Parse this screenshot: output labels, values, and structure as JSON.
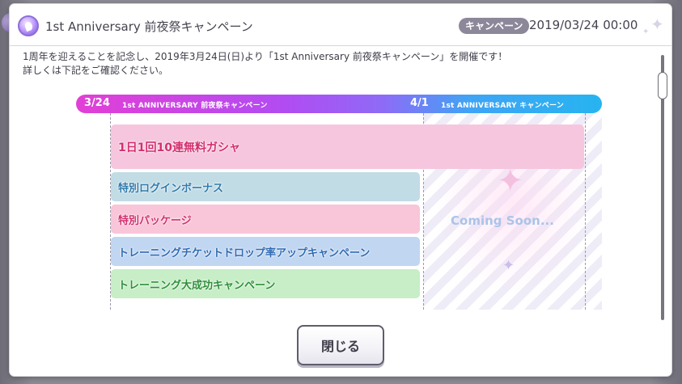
{
  "modal": {
    "title": "1st Anniversary 前夜祭キャンペーン",
    "badge": "キャンペーン",
    "date": "2019/03/24 00:00",
    "close_label": "閉じる"
  },
  "intro": {
    "line1": "1周年を迎えることを記念し、2019年3月24日(日)より「1st Anniversary 前夜祭キャンペーン」を開催です！",
    "line2": "詳しくは下記をご確認ください。"
  },
  "timeline": {
    "start_date": "3/24",
    "start_label": "1st ANNIVERSARY 前夜祭キャンペーン",
    "second_date": "4/1",
    "second_label": "1st ANNIVERSARY キャンペーン",
    "coming_soon": "Coming Soon..."
  },
  "campaigns": [
    {
      "label": "1日1回10連無料ガシャ"
    },
    {
      "label": "特別ログインボーナス"
    },
    {
      "label": "特別パッケージ"
    },
    {
      "label": "トレーニングチケットドロップ率アップキャンペーン"
    },
    {
      "label": "トレーニング大成功キャンペーン"
    }
  ],
  "colors": {
    "gacha": "#f6c6df",
    "login": "#c2dce6",
    "package": "#f9c5d8",
    "training_ticket": "#c1d6f1",
    "training_success": "#c7eec7"
  }
}
